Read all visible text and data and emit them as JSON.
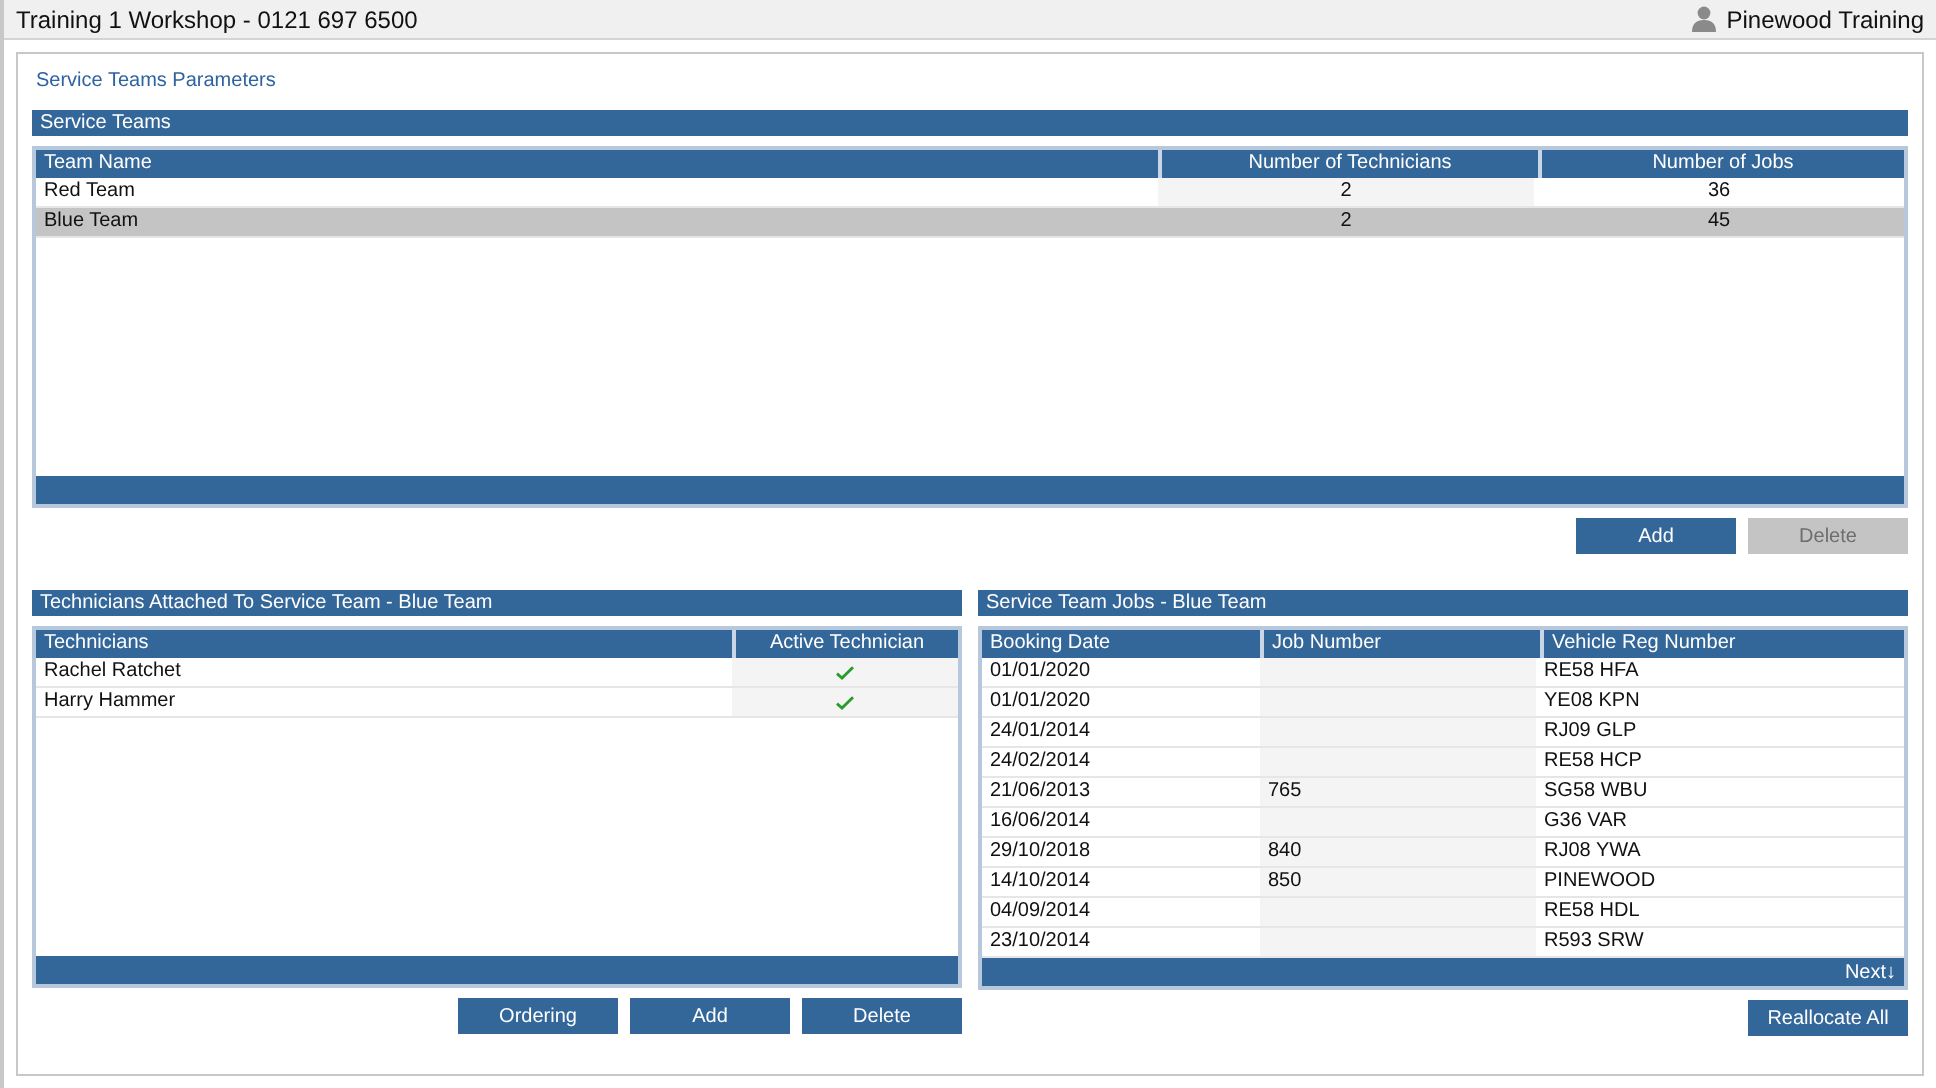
{
  "window": {
    "title": "Training 1 Workshop - 0121 697 6500",
    "user": "Pinewood Training"
  },
  "page_title": "Service Teams Parameters",
  "service_teams": {
    "title": "Service Teams",
    "columns": [
      "Team Name",
      "Number of Technicians",
      "Number of Jobs"
    ],
    "rows": [
      {
        "cells": [
          "Red Team",
          "2",
          "36"
        ],
        "selected": false
      },
      {
        "cells": [
          "Blue Team",
          "2",
          "45"
        ],
        "selected": true
      }
    ],
    "buttons": [
      {
        "label": "Add",
        "disabled": false
      },
      {
        "label": "Delete",
        "disabled": true
      }
    ]
  },
  "technicians": {
    "title": "Technicians Attached To Service Team - Blue Team",
    "columns": [
      "Technicians",
      "Active Technician"
    ],
    "rows": [
      {
        "name": "Rachel Ratchet",
        "active": true
      },
      {
        "name": "Harry Hammer",
        "active": true
      }
    ],
    "buttons": [
      {
        "label": "Ordering",
        "disabled": false
      },
      {
        "label": "Add",
        "disabled": false
      },
      {
        "label": "Delete",
        "disabled": false
      }
    ]
  },
  "jobs": {
    "title": "Service Team Jobs - Blue Team",
    "columns": [
      "Booking Date",
      "Job Number",
      "Vehicle Reg Number"
    ],
    "rows": [
      [
        "01/01/2020",
        "",
        "RE58 HFA"
      ],
      [
        "01/01/2020",
        "",
        "YE08 KPN"
      ],
      [
        "24/01/2014",
        "",
        "RJ09 GLP"
      ],
      [
        "24/02/2014",
        "",
        "RE58 HCP"
      ],
      [
        "21/06/2013",
        "765",
        "SG58 WBU"
      ],
      [
        "16/06/2014",
        "",
        "G36 VAR"
      ],
      [
        "29/10/2018",
        "840",
        "RJ08 YWA"
      ],
      [
        "14/10/2014",
        "850",
        "PINEWOOD"
      ],
      [
        "04/09/2014",
        "",
        "RE58 HDL"
      ],
      [
        "23/10/2014",
        "",
        "R593 SRW"
      ]
    ],
    "next_label": "Next↓",
    "buttons": [
      {
        "label": "Reallocate All",
        "disabled": false
      }
    ]
  }
}
